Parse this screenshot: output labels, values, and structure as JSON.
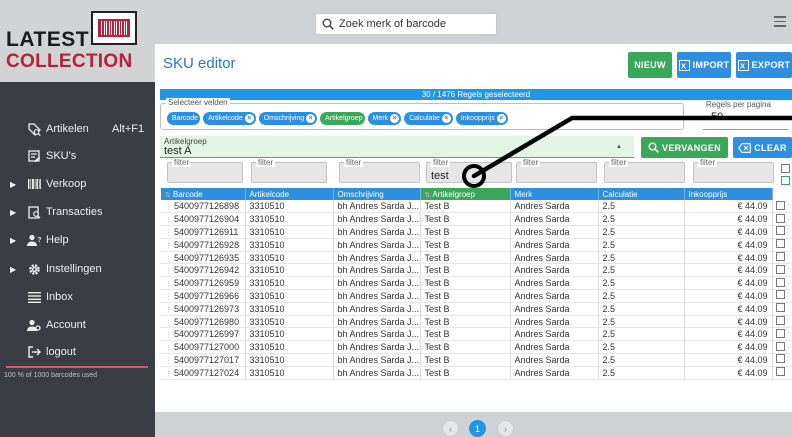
{
  "logo": {
    "line1": "LATEST",
    "line2": "COLLECTION"
  },
  "sidebar": {
    "items": [
      {
        "label": "Artikelen",
        "shortcut": "Alt+F1",
        "icon": "tags-search-icon",
        "caret": ""
      },
      {
        "label": "SKU's",
        "shortcut": "",
        "icon": "sku-edit-icon",
        "caret": ""
      },
      {
        "label": "Verkoop",
        "shortcut": "",
        "icon": "barcode-icon",
        "caret": "▶"
      },
      {
        "label": "Transacties",
        "shortcut": "",
        "icon": "receipt-search-icon",
        "caret": "▶"
      },
      {
        "label": "Help",
        "shortcut": "",
        "icon": "help-user-icon",
        "caret": "▶"
      },
      {
        "label": "Instellingen",
        "shortcut": "",
        "icon": "gear-icon",
        "caret": "▶"
      },
      {
        "label": "Inbox",
        "shortcut": "",
        "icon": "inbox-icon",
        "caret": ""
      },
      {
        "label": "Account",
        "shortcut": "",
        "icon": "account-gear-icon",
        "caret": ""
      },
      {
        "label": "logout",
        "shortcut": "",
        "icon": "logout-icon",
        "caret": ""
      }
    ],
    "usage": "100 % of 1000 barcodes used"
  },
  "search": {
    "placeholder": "Zoek merk of barcode"
  },
  "panel": {
    "title": "SKU editor",
    "buttons": {
      "nieuw": "NIEUW",
      "import": "IMPORT",
      "export": "EXPORT",
      "vervangen": "VERVANGEN",
      "clear": "CLEAR"
    },
    "selection_info": "30 / 1476 Regels geselecteerd",
    "select_fields_label": "Selecteer velden",
    "chips": [
      "Barcode",
      "Artikelcode",
      "Omschrijving",
      "Artikelgroep",
      "Merk",
      "Calculatie",
      "Inkoopprijs"
    ],
    "rows_per_page_label": "Regels per pagina",
    "rows_per_page": "50",
    "artikelgroep_label": "Artikelgroep",
    "artikelgroep_value": "test A",
    "filter_label": "filter",
    "filter_values": [
      "",
      "",
      "",
      "test",
      "",
      "",
      ""
    ]
  },
  "colors": {
    "blue": "#2e8fe0",
    "green": "#3aa75a",
    "brand_red": "#b8213b",
    "sidebar": "#3a3e44"
  },
  "table": {
    "headers": [
      "Barcode",
      "Artikelcode",
      "Omschrijving",
      "Artikelgroep",
      "Merk",
      "Calculatie",
      "Inkoopprijs"
    ],
    "rows": [
      [
        "5400977126898",
        "3310510",
        "bh Andres Sarda J...",
        "Test B",
        "Andres Sarda",
        "2.5",
        "€ 44.09"
      ],
      [
        "5400977126904",
        "3310510",
        "bh Andres Sarda J...",
        "Test B",
        "Andres Sarda",
        "2.5",
        "€ 44.09"
      ],
      [
        "5400977126911",
        "3310510",
        "bh Andres Sarda J...",
        "Test B",
        "Andres Sarda",
        "2.5",
        "€ 44.09"
      ],
      [
        "5400977126928",
        "3310510",
        "bh Andres Sarda J...",
        "Test B",
        "Andres Sarda",
        "2.5",
        "€ 44.09"
      ],
      [
        "5400977126935",
        "3310510",
        "bh Andres Sarda J...",
        "Test B",
        "Andres Sarda",
        "2.5",
        "€ 44.09"
      ],
      [
        "5400977126942",
        "3310510",
        "bh Andres Sarda J...",
        "Test B",
        "Andres Sarda",
        "2.5",
        "€ 44.09"
      ],
      [
        "5400977126959",
        "3310510",
        "bh Andres Sarda J...",
        "Test B",
        "Andres Sarda",
        "2.5",
        "€ 44.09"
      ],
      [
        "5400977126966",
        "3310510",
        "bh Andres Sarda J...",
        "Test B",
        "Andres Sarda",
        "2.5",
        "€ 44.09"
      ],
      [
        "5400977126973",
        "3310510",
        "bh Andres Sarda J...",
        "Test B",
        "Andres Sarda",
        "2.5",
        "€ 44.09"
      ],
      [
        "5400977126980",
        "3310510",
        "bh Andres Sarda J...",
        "Test B",
        "Andres Sarda",
        "2.5",
        "€ 44.09"
      ],
      [
        "5400977126997",
        "3310510",
        "bh Andres Sarda J...",
        "Test B",
        "Andres Sarda",
        "2.5",
        "€ 44.09"
      ],
      [
        "5400977127000",
        "3310510",
        "bh Andres Sarda J...",
        "Test B",
        "Andres Sarda",
        "2.5",
        "€ 44.09"
      ],
      [
        "5400977127017",
        "3310510",
        "bh Andres Sarda J...",
        "Test B",
        "Andres Sarda",
        "2.5",
        "€ 44.09"
      ],
      [
        "5400977127024",
        "3310510",
        "bh Andres Sarda J...",
        "Test B",
        "Andres Sarda",
        "2.5",
        "€ 44.09"
      ]
    ]
  },
  "pager": {
    "prev": "‹",
    "current": "1",
    "next": "›"
  }
}
